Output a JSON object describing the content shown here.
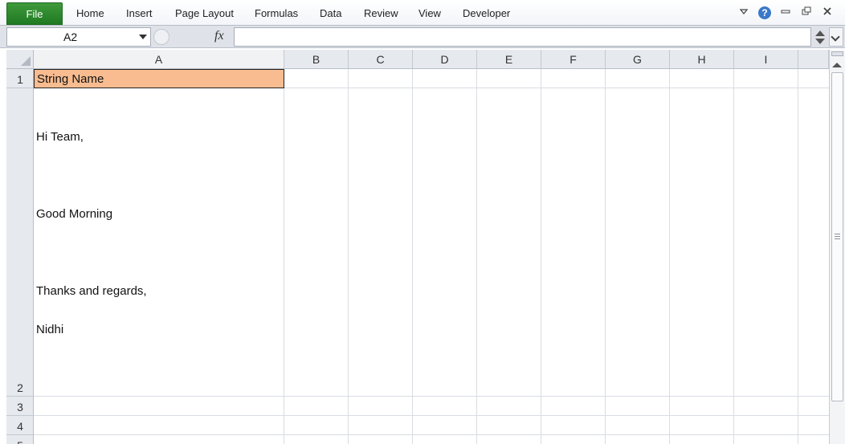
{
  "ribbon": {
    "file_label": "File",
    "tabs": [
      "Home",
      "Insert",
      "Page Layout",
      "Formulas",
      "Data",
      "Review",
      "View",
      "Developer"
    ]
  },
  "window_controls": {
    "help_label": "?",
    "icons": [
      "ribbon-minimize-icon",
      "help-icon",
      "minimize-icon",
      "restore-icon",
      "close-icon"
    ]
  },
  "formula_bar": {
    "name_box": "A2",
    "fx_label": "fx",
    "formula_value": ""
  },
  "grid": {
    "columns": [
      "A",
      "B",
      "C",
      "D",
      "E",
      "F",
      "G",
      "H",
      "I"
    ],
    "rows": [
      "1",
      "2",
      "3",
      "4",
      "5"
    ],
    "a1": "String Name",
    "a1_fill": "#f8bc90",
    "a2_lines": [
      "Hi Team,",
      "Good Morning",
      "Thanks and regards,",
      "Nidhi"
    ]
  }
}
